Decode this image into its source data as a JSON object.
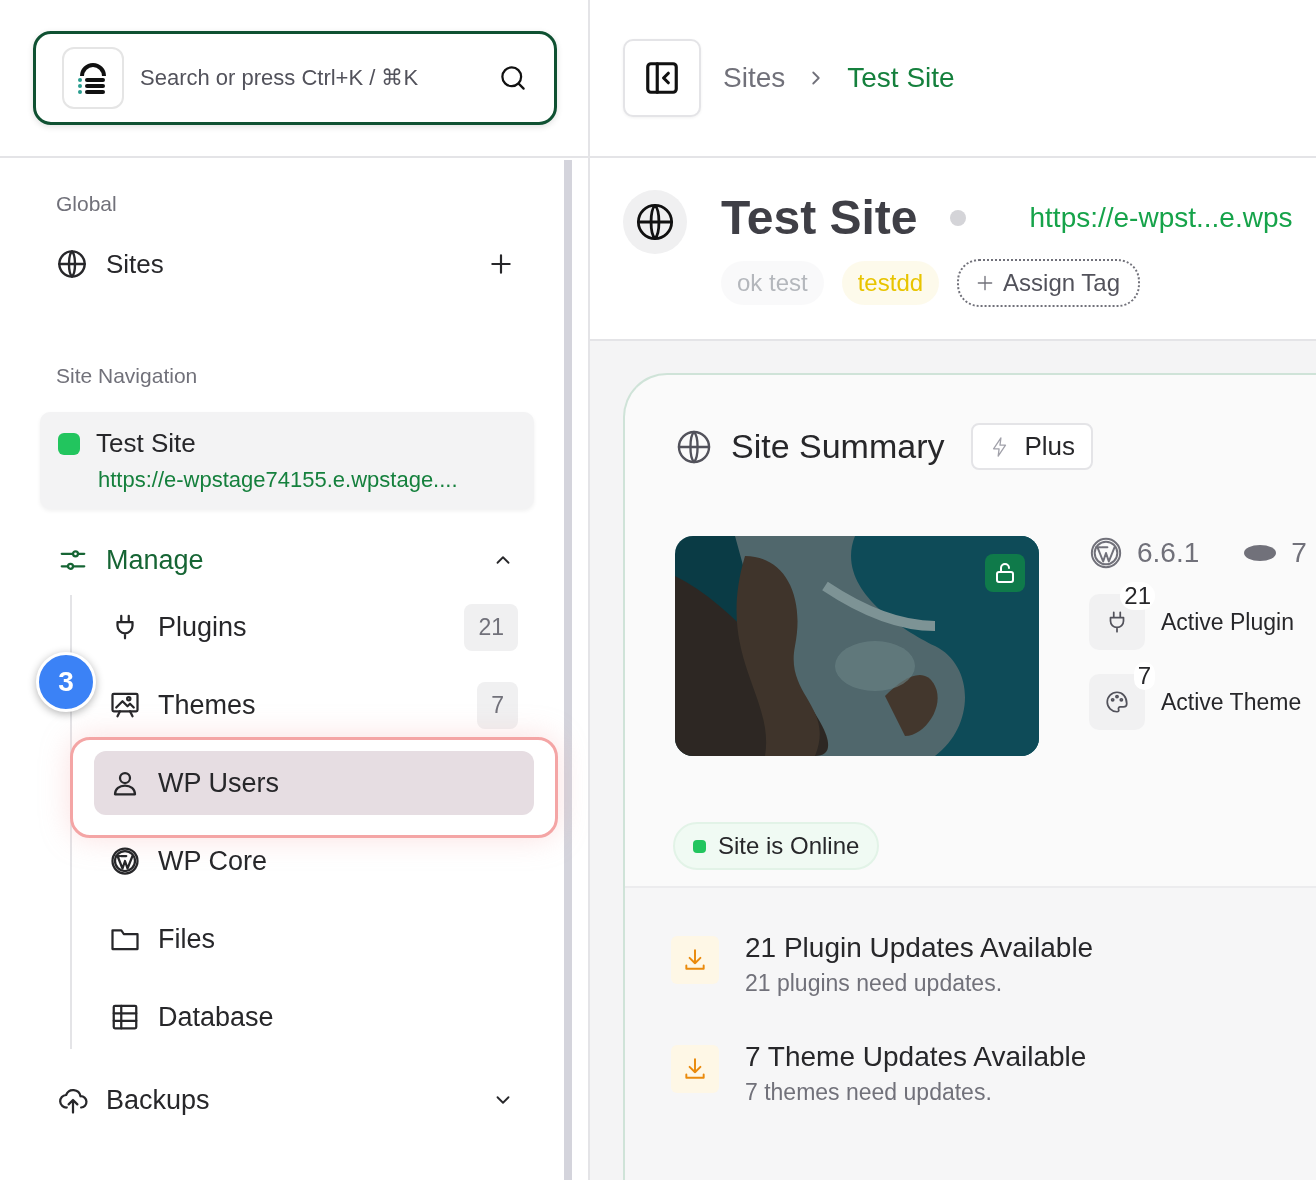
{
  "search": {
    "placeholder": "Search or press Ctrl+K / ⌘K"
  },
  "sidebar": {
    "global_label": "Global",
    "sites_label": "Sites",
    "site_nav_label": "Site Navigation",
    "current_site": {
      "name": "Test Site",
      "url": "https://e-wpstage74155.e.wpstage...."
    },
    "nav": [
      {
        "label": "Manage",
        "expanded": true,
        "children": [
          {
            "label": "Plugins",
            "count": "21",
            "selected": false
          },
          {
            "label": "Themes",
            "count": "7",
            "selected": false
          },
          {
            "label": "WP Users",
            "selected": true
          },
          {
            "label": "WP Core",
            "selected": false
          },
          {
            "label": "Files",
            "selected": false
          },
          {
            "label": "Database",
            "selected": false
          }
        ]
      },
      {
        "label": "Backups",
        "expanded": false
      }
    ],
    "tour_step": "3"
  },
  "breadcrumb": [
    {
      "label": "Sites",
      "selected": false
    },
    {
      "label": "Test Site",
      "selected": true
    }
  ],
  "site": {
    "title": "Test Site",
    "url": "https://e-wpst...e.wps",
    "tags": [
      {
        "label": "ok test",
        "color": "#b4b7bc"
      },
      {
        "label": "testdd",
        "color": "#e8c400"
      }
    ],
    "assign_tag": "Assign Tag"
  },
  "summary": {
    "title": "Site Summary",
    "plan": "Plus",
    "wp_version": "6.6.1",
    "php_version": "7",
    "stats": [
      {
        "count": "21",
        "label": "Active Plugin"
      },
      {
        "count": "7",
        "label": "Active Theme"
      }
    ],
    "status": "Site is Online",
    "updates": [
      {
        "title": "21 Plugin Updates Available",
        "subtitle": "21 plugins need updates."
      },
      {
        "title": "7 Theme Updates Available",
        "subtitle": "7 themes need updates."
      }
    ]
  }
}
